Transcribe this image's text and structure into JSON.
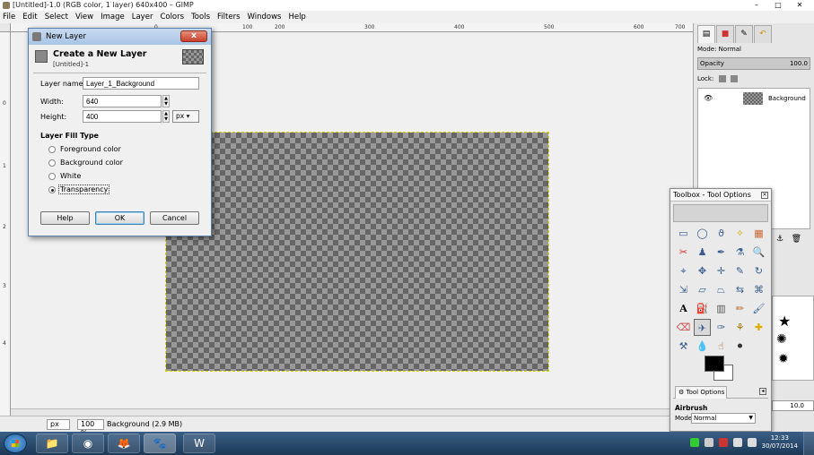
{
  "window": {
    "title": "[Untitled]-1.0 (RGB color, 1 layer) 640x400 – GIMP",
    "minimize": "–",
    "maximize": "□",
    "close": "✕"
  },
  "menu": [
    "File",
    "Edit",
    "Select",
    "View",
    "Image",
    "Layer",
    "Colors",
    "Tools",
    "Filters",
    "Windows",
    "Help"
  ],
  "ruler": {
    "h_ticks": [
      "0",
      "100",
      "200",
      "300",
      "400",
      "500",
      "600",
      "700"
    ],
    "v_ticks": [
      "0",
      "1",
      "2",
      "3",
      "4"
    ]
  },
  "status": {
    "unit": "px",
    "zoom": "100 %",
    "info": "Background (2.9 MB)"
  },
  "dialog": {
    "title": "New Layer",
    "close": "x",
    "heading": "Create a New Layer",
    "subheading": "[Untitled]-1",
    "layer_name_label": "Layer name:",
    "layer_name_value": "Layer_1_Background",
    "width_label": "Width:",
    "width_value": "640",
    "height_label": "Height:",
    "height_value": "400",
    "unit": "px",
    "fill_type_title": "Layer Fill Type",
    "fill_options": [
      "Foreground color",
      "Background color",
      "White",
      "Transparency"
    ],
    "selected_fill": "Transparency",
    "help_button": "Help",
    "ok_button": "OK",
    "cancel_button": "Cancel"
  },
  "layers_dock": {
    "mode_label": "Mode:",
    "mode_value": "Normal",
    "opacity_label": "Opacity",
    "opacity_value": "100.0",
    "lock_label": "Lock:",
    "layers": [
      {
        "name": "Background",
        "visible": true
      }
    ],
    "spin_value": "10.0"
  },
  "toolbox": {
    "title": "Toolbox - Tool Options",
    "tab_label": "Tool Options",
    "options_title": "Airbrush",
    "mode_label": "Mode:",
    "mode_value": "Normal",
    "foreground_color": "#000000",
    "background_color": "#ffffff"
  },
  "taskbar": {
    "time": "12:33",
    "date": "30/07/2014"
  }
}
